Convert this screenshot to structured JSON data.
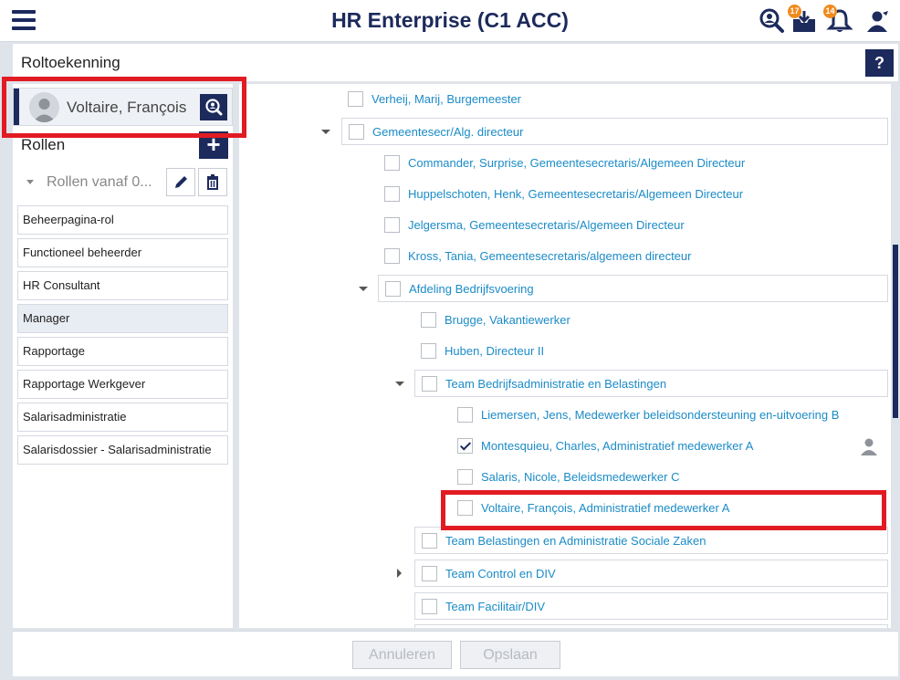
{
  "header": {
    "title": "HR Enterprise (C1 ACC)",
    "inbox_badge": "17",
    "notifications_badge": "14"
  },
  "page": {
    "title": "Roltoekenning",
    "help_label": "?"
  },
  "left_panel": {
    "selected_user": "Voltaire, François",
    "roles_header": "Rollen",
    "add_label": "+",
    "roles_since_label": "Rollen vanaf 0...",
    "roles": [
      "Beheerpagina-rol",
      "Functioneel beheerder",
      "HR Consultant",
      "Manager",
      "Rapportage",
      "Rapportage Werkgever",
      "Salarisadministratie",
      "Salarisdossier - Salarisadministratie"
    ],
    "active_role": "Manager"
  },
  "tree": {
    "items": [
      "Verheij, Marij, Burgemeester",
      "Gemeentesecr/Alg. directeur",
      "Commander, Surprise, Gemeentesecretaris/Algemeen Directeur",
      "Huppelschoten, Henk, Gemeentesecretaris/Algemeen Directeur",
      "Jelgersma, Gemeentesecretaris/Algemeen Directeur",
      "Kross, Tania, Gemeentesecretaris/algemeen directeur",
      "Afdeling Bedrijfsvoering",
      "Brugge, Vakantiewerker",
      "Huben, Directeur II",
      "Team Bedrijfsadministratie en Belastingen",
      "Liemersen, Jens, Medewerker beleidsondersteuning en-uitvoering B",
      "Montesquieu, Charles, Administratief medewerker A",
      "Salaris, Nicole, Beleidsmedewerker C",
      "Voltaire, François, Administratief medewerker A",
      "Team Belastingen en Administratie Sociale Zaken",
      "Team Control en DIV",
      "Team Facilitair/DIV"
    ],
    "checked_item": "Montesquieu, Charles, Administratief medewerker A"
  },
  "footer": {
    "cancel_label": "Annuleren",
    "save_label": "Opslaan"
  },
  "colors": {
    "primary": "#1c2a5c",
    "link": "#1b8bc7",
    "badge": "#f08a1c",
    "highlight": "#e21b23"
  }
}
